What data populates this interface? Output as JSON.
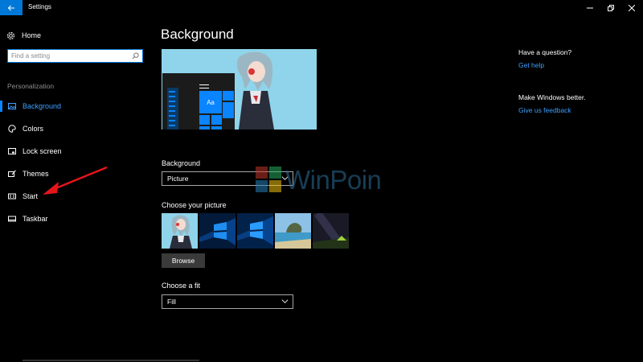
{
  "window": {
    "title": "Settings",
    "accent": "#0078d7"
  },
  "sidebar": {
    "home_label": "Home",
    "search_placeholder": "Find a setting",
    "section_label": "Personalization",
    "items": [
      {
        "label": "Background",
        "icon": "picture-icon",
        "active": true
      },
      {
        "label": "Colors",
        "icon": "palette-icon",
        "active": false
      },
      {
        "label": "Lock screen",
        "icon": "lock-screen-icon",
        "active": false
      },
      {
        "label": "Themes",
        "icon": "themes-icon",
        "active": false
      },
      {
        "label": "Start",
        "icon": "start-icon",
        "active": false
      },
      {
        "label": "Taskbar",
        "icon": "taskbar-icon",
        "active": false
      }
    ]
  },
  "main": {
    "title": "Background",
    "preview_tile_text": "Aa",
    "background_label": "Background",
    "background_value": "Picture",
    "choose_picture_label": "Choose your picture",
    "browse_label": "Browse",
    "fit_label": "Choose a fit",
    "fit_value": "Fill",
    "thumbnails": [
      "anime-character",
      "windows-hero-blue",
      "windows-hero-blue-2",
      "beach-rock",
      "night-sky-tent"
    ]
  },
  "help": {
    "question_title": "Have a question?",
    "question_link": "Get help",
    "feedback_title": "Make Windows better.",
    "feedback_link": "Give us feedback"
  },
  "watermark": {
    "text": "WinPoin"
  }
}
